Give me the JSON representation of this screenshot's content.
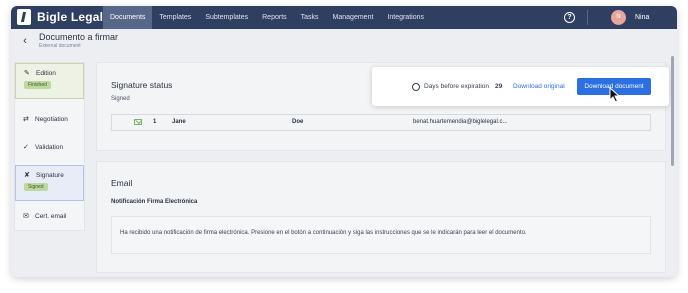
{
  "app": {
    "brand": "Bigle Legal",
    "colors": {
      "nav_bg": "#2f3f62",
      "nav_active": "#56678a",
      "accent": "#2b6fe0",
      "badge_bg": "#bfd8a0"
    }
  },
  "nav": {
    "items": [
      "Documents",
      "Templates",
      "Subtemplates",
      "Reports",
      "Tasks",
      "Management",
      "Integrations"
    ],
    "active": "Documents",
    "help_icon": "?",
    "user": {
      "initial": "N",
      "name": "Nina"
    }
  },
  "header": {
    "title": "Documento a firmar",
    "subtitle": "External document",
    "back_icon": "chevron-left-icon"
  },
  "sidebar": {
    "items": [
      {
        "label": "Edition",
        "icon": "edit-icon",
        "badge": "Finished"
      },
      {
        "label": "Negotiation",
        "icon": "negotiation-icon",
        "badge": ""
      },
      {
        "label": "Validation",
        "icon": "check-circle-icon",
        "badge": ""
      },
      {
        "label": "Signature",
        "icon": "signature-icon",
        "badge": "Signed"
      },
      {
        "label": "Cert. email",
        "icon": "mail-icon",
        "badge": ""
      }
    ]
  },
  "signature": {
    "title": "Signature status",
    "status": "Signed",
    "expiry_label": "Days before expiration",
    "expiry_days": "29",
    "download_original": "Download original",
    "download_document": "Download document",
    "signer": {
      "index": "1",
      "first_name": "Jane",
      "last_name": "Doe",
      "email": "benat.huartemendia@biglelegal.c..."
    }
  },
  "email": {
    "title": "Email",
    "notification_title": "Notificación Firma Electrónica",
    "body": "Ha recibido una notificación de firma electrónica. Presione en el botón a continuación y siga las instrucciones que se le indicarán para leer el documento."
  }
}
